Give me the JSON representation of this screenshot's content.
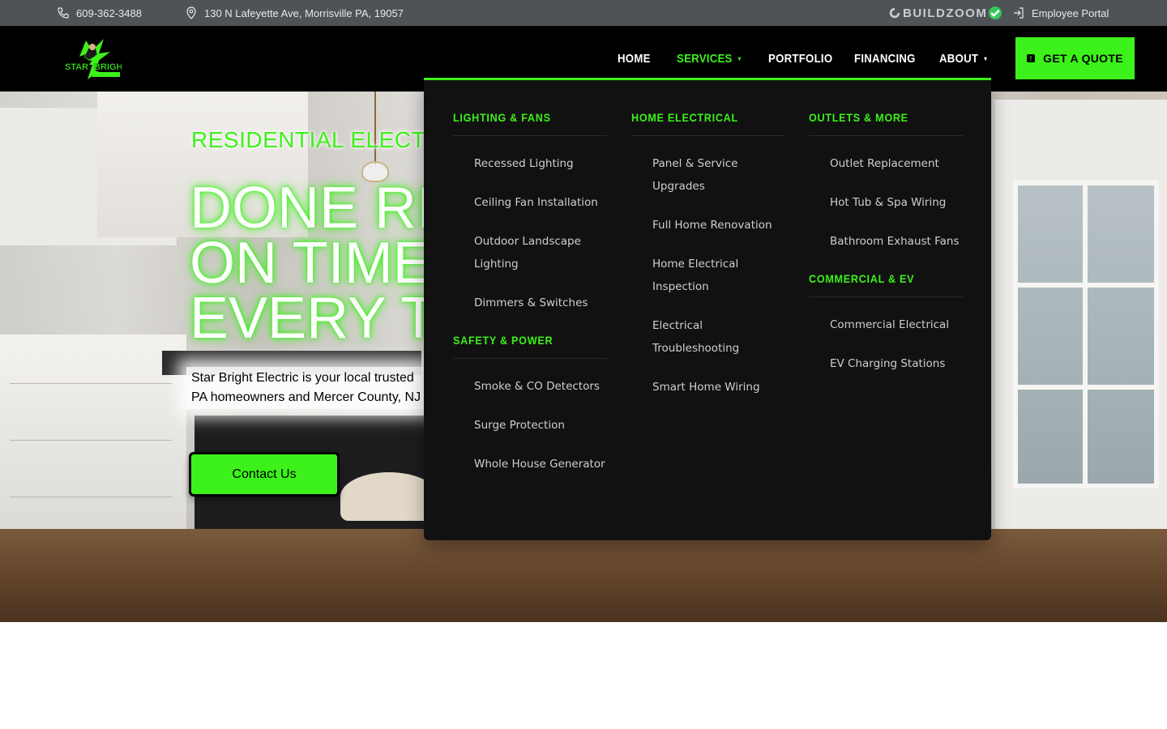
{
  "topbar": {
    "phone": "609-362-3488",
    "address": "130 N Lafeyette Ave, Morrisville PA, 19057",
    "buildzoom": "BUILDZOOM",
    "portal": "Employee Portal"
  },
  "logo": {
    "text": "STAR BRIGHT"
  },
  "nav": {
    "home": "HOME",
    "services": "SERVICES",
    "portfolio": "PORTFOLIO",
    "financing": "FINANCING",
    "about": "ABOUT",
    "quote": "GET A QUOTE"
  },
  "hero": {
    "eyebrow": "RESIDENTIAL ELECTRICIAN",
    "headline": [
      "DONE RIGHT",
      "ON TIME",
      "EVERY TIME"
    ],
    "sub": [
      "Star Bright Electric is your local trusted",
      "PA homeowners and Mercer County, NJ"
    ],
    "contact": "Contact Us"
  },
  "mega": {
    "lighting": {
      "title": "LIGHTING & FANS",
      "items": [
        "Recessed Lighting",
        "Ceiling Fan Installation",
        "Outdoor Landscape Lighting",
        "Dimmers & Switches"
      ]
    },
    "safety": {
      "title": "SAFETY & POWER",
      "items": [
        "Smoke & CO Detectors",
        "Surge Protection",
        "Whole House Generator"
      ]
    },
    "home": {
      "title": "HOME ELECTRICAL",
      "items": [
        "Panel & Service Upgrades",
        "Full Home Renovation",
        "Home Electrical Inspection",
        "Electrical Troubleshooting",
        "Smart Home Wiring"
      ]
    },
    "outlets": {
      "title": "OUTLETS & MORE",
      "items": [
        "Outlet Replacement",
        "Hot Tub & Spa Wiring",
        "Bathroom Exhaust Fans"
      ]
    },
    "commercial": {
      "title": "COMMERCIAL & EV",
      "items": [
        "Commercial Electrical",
        "EV Charging Stations"
      ]
    }
  },
  "colors": {
    "accent": "#3cf21a",
    "nav_bg": "#000000",
    "topbar_bg": "#4e5358",
    "menu_bg": "#111111"
  }
}
